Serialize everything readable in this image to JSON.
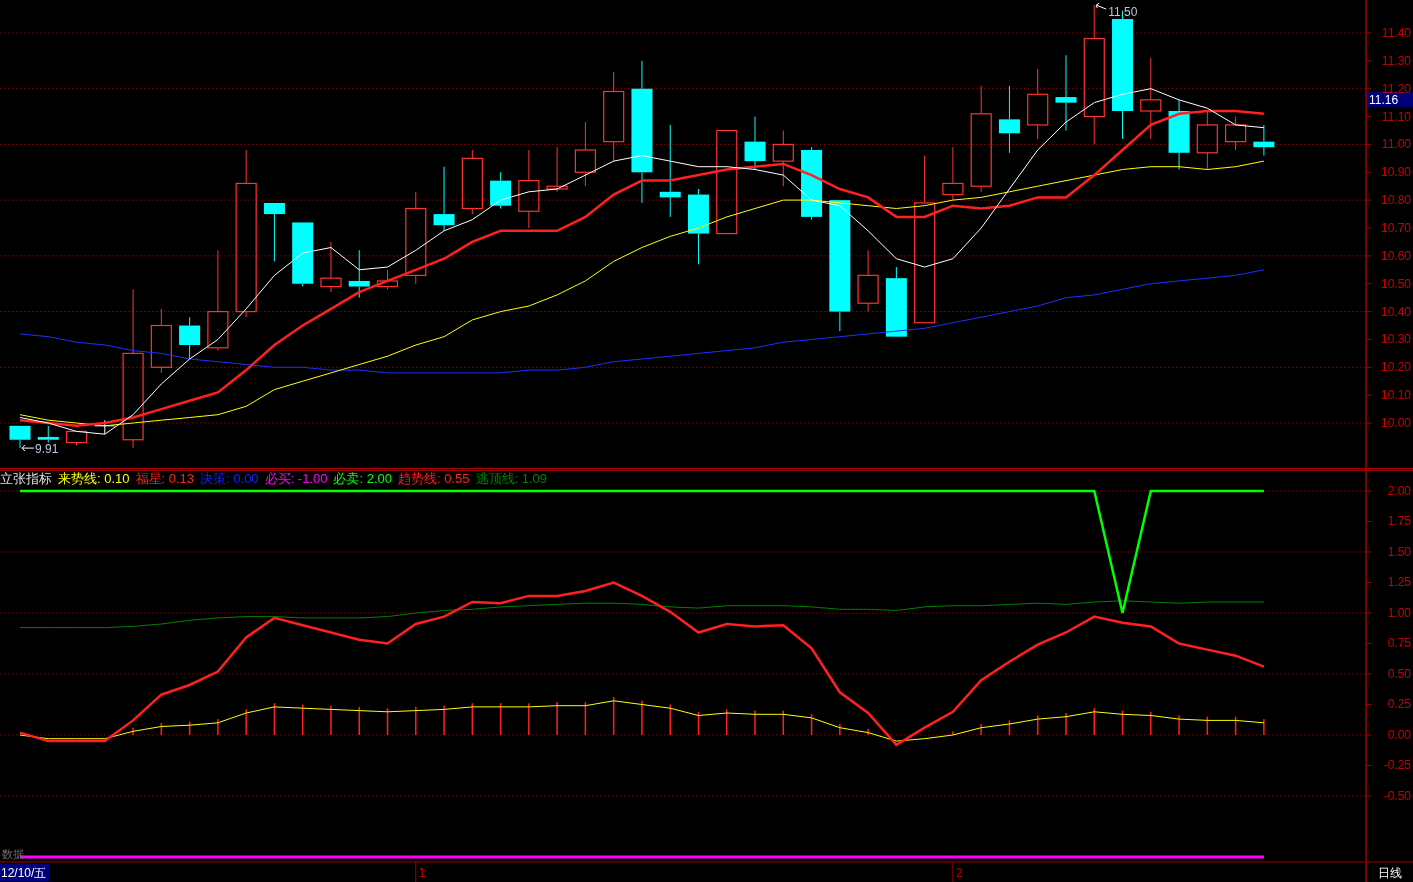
{
  "main_chart": {
    "chart_data": {
      "type": "line",
      "grid": true,
      "ylim": [
        9.8386,
        11.5184
      ],
      "yticks": [
        {
          "value": 10.0,
          "label": "10.00"
        },
        {
          "value": 10.1,
          "label": "10.10"
        },
        {
          "value": 10.2,
          "label": "10.20"
        },
        {
          "value": 10.3,
          "label": "10.30"
        },
        {
          "value": 10.4,
          "label": "10.40"
        },
        {
          "value": 10.5,
          "label": "10.50"
        },
        {
          "value": 10.6,
          "label": "10.60"
        },
        {
          "value": 10.7,
          "label": "10.70"
        },
        {
          "value": 10.8,
          "label": "10.80"
        },
        {
          "value": 10.9,
          "label": "10.90"
        },
        {
          "value": 11.0,
          "label": "11.00"
        },
        {
          "value": 11.1,
          "label": "11.10"
        },
        {
          "value": 11.2,
          "label": "11.20"
        },
        {
          "value": 11.3,
          "label": "11.30"
        },
        {
          "value": 11.4,
          "label": "11.40"
        }
      ],
      "series": [
        {
          "type": "candlestick",
          "ohlc": [
            [
              9.99,
              9.99,
              9.91,
              9.94
            ],
            [
              9.95,
              9.99,
              9.93,
              9.94
            ],
            [
              9.93,
              9.97,
              9.92,
              9.97
            ],
            [
              9.99,
              10.01,
              9.96,
              9.99
            ],
            [
              9.94,
              10.48,
              9.91,
              10.25
            ],
            [
              10.2,
              10.41,
              10.18,
              10.35
            ],
            [
              10.35,
              10.38,
              10.23,
              10.28
            ],
            [
              10.27,
              10.62,
              10.26,
              10.4
            ],
            [
              10.4,
              10.98,
              10.38,
              10.86
            ],
            [
              10.79,
              10.79,
              10.58,
              10.75
            ],
            [
              10.72,
              10.72,
              10.49,
              10.5
            ],
            [
              10.49,
              10.65,
              10.47,
              10.52
            ],
            [
              10.51,
              10.62,
              10.45,
              10.49
            ],
            [
              10.49,
              10.55,
              10.48,
              10.51
            ],
            [
              10.53,
              10.83,
              10.5,
              10.77
            ],
            [
              10.75,
              10.92,
              10.69,
              10.71
            ],
            [
              10.77,
              10.98,
              10.75,
              10.95
            ],
            [
              10.87,
              10.9,
              10.77,
              10.78
            ],
            [
              10.76,
              10.98,
              10.7,
              10.87
            ],
            [
              10.84,
              10.99,
              10.83,
              10.85
            ],
            [
              10.9,
              11.08,
              10.85,
              10.98
            ],
            [
              11.01,
              11.26,
              10.94,
              11.19
            ],
            [
              11.2,
              11.3,
              10.79,
              10.9
            ],
            [
              10.83,
              11.07,
              10.74,
              10.81
            ],
            [
              10.82,
              10.84,
              10.57,
              10.68
            ],
            [
              10.68,
              11.05,
              10.68,
              11.05
            ],
            [
              11.01,
              11.1,
              10.91,
              10.94
            ],
            [
              10.94,
              11.05,
              10.85,
              11.0
            ],
            [
              10.98,
              10.99,
              10.73,
              10.74
            ],
            [
              10.8,
              10.8,
              10.33,
              10.4
            ],
            [
              10.43,
              10.62,
              10.4,
              10.53
            ],
            [
              10.52,
              10.56,
              10.31,
              10.31
            ],
            [
              10.36,
              10.96,
              10.36,
              10.79
            ],
            [
              10.82,
              10.99,
              10.8,
              10.86
            ],
            [
              10.85,
              11.21,
              10.83,
              11.11
            ],
            [
              11.09,
              11.21,
              10.97,
              11.04
            ],
            [
              11.07,
              11.27,
              11.02,
              11.18
            ],
            [
              11.17,
              11.32,
              11.05,
              11.15
            ],
            [
              11.1,
              11.5,
              11.0,
              11.38
            ],
            [
              11.45,
              11.48,
              11.02,
              11.12
            ],
            [
              11.12,
              11.31,
              11.02,
              11.16
            ],
            [
              11.12,
              11.16,
              10.91,
              10.97
            ],
            [
              10.97,
              11.12,
              10.91,
              11.07
            ],
            [
              11.01,
              11.1,
              10.98,
              11.07
            ],
            [
              11.01,
              11.07,
              10.96,
              10.99
            ]
          ]
        },
        {
          "type": "line",
          "color": "#2030ff",
          "values": [
            10.32,
            10.31,
            10.29,
            10.28,
            10.26,
            10.25,
            10.23,
            10.22,
            10.21,
            10.2,
            10.2,
            10.19,
            10.19,
            10.18,
            10.18,
            10.18,
            10.18,
            10.18,
            10.19,
            10.19,
            10.2,
            10.22,
            10.23,
            10.24,
            10.25,
            10.26,
            10.27,
            10.29,
            10.3,
            10.31,
            10.32,
            10.33,
            10.34,
            10.36,
            10.38,
            10.4,
            10.42,
            10.45,
            10.46,
            10.48,
            10.5,
            10.51,
            10.52,
            10.53,
            10.55
          ]
        },
        {
          "type": "line",
          "color": "#ffff00",
          "values": [
            10.03,
            10.01,
            10.0,
            9.99,
            10.0,
            10.01,
            10.02,
            10.03,
            10.06,
            10.12,
            10.15,
            10.18,
            10.21,
            10.24,
            10.28,
            10.31,
            10.37,
            10.4,
            10.42,
            10.46,
            10.51,
            10.58,
            10.63,
            10.67,
            10.7,
            10.74,
            10.77,
            10.8,
            10.8,
            10.79,
            10.78,
            10.77,
            10.78,
            10.8,
            10.81,
            10.83,
            10.85,
            10.87,
            10.89,
            10.91,
            10.92,
            10.92,
            10.91,
            10.92,
            10.94
          ]
        },
        {
          "type": "line",
          "color": "#ff2020",
          "values": [
            10.01,
            10.0,
            9.99,
            10.0,
            10.02,
            10.05,
            10.08,
            10.11,
            10.19,
            10.28,
            10.35,
            10.41,
            10.47,
            10.51,
            10.55,
            10.59,
            10.65,
            10.69,
            10.69,
            10.69,
            10.74,
            10.82,
            10.87,
            10.87,
            10.89,
            10.91,
            10.92,
            10.93,
            10.89,
            10.84,
            10.81,
            10.74,
            10.74,
            10.78,
            10.77,
            10.78,
            10.81,
            10.81,
            10.89,
            10.98,
            11.07,
            11.11,
            11.12,
            11.12,
            11.11
          ]
        },
        {
          "type": "line",
          "color": "#ffffff",
          "values": [
            10.02,
            10.0,
            9.97,
            9.96,
            10.03,
            10.14,
            10.23,
            10.3,
            10.41,
            10.53,
            10.61,
            10.63,
            10.55,
            10.56,
            10.62,
            10.69,
            10.73,
            10.8,
            10.83,
            10.84,
            10.89,
            10.94,
            10.96,
            10.94,
            10.92,
            10.92,
            10.91,
            10.89,
            10.8,
            10.78,
            10.69,
            10.59,
            10.56,
            10.59,
            10.7,
            10.84,
            10.98,
            11.08,
            11.15,
            11.18,
            11.2,
            11.16,
            11.13,
            11.07,
            11.06
          ]
        }
      ],
      "annotations": [
        "11.50",
        "9.91",
        "11.16"
      ]
    }
  },
  "indicator_panel": {
    "title": "立张指标",
    "legend": [
      {
        "label": "来势线:",
        "value": "0.10",
        "color": "#ffff00"
      },
      {
        "label": "福星:",
        "value": "0.13",
        "color": "#ff2020"
      },
      {
        "label": "决策:",
        "value": "0.00",
        "color": "#1020ff"
      },
      {
        "label": "必买:",
        "value": "-1.00",
        "color": "#ff00ff"
      },
      {
        "label": "必卖:",
        "value": "2.00",
        "color": "#00ff00"
      },
      {
        "label": "趋势线:",
        "value": "0.55",
        "color": "#ff2020"
      },
      {
        "label": "逃顶线:",
        "value": "1.09",
        "color": "#008000"
      }
    ],
    "chart_data": {
      "type": "line",
      "grid": true,
      "ylim": [
        -1.041,
        2.172
      ],
      "yticks": [
        {
          "value": -0.5,
          "label": "-0.50"
        },
        {
          "value": -0.25,
          "label": "-0.25"
        },
        {
          "value": 0,
          "label": "0.00"
        },
        {
          "value": 0.25,
          "label": "0.25"
        },
        {
          "value": 0.5,
          "label": "0.50"
        },
        {
          "value": 0.75,
          "label": "0.75"
        },
        {
          "value": 1,
          "label": "1.00"
        },
        {
          "value": 1.25,
          "label": "1.25"
        },
        {
          "value": 1.5,
          "label": "1.50"
        },
        {
          "value": 1.75,
          "label": "1.75"
        },
        {
          "value": 2,
          "label": "2.00"
        }
      ],
      "series": [
        {
          "type": "bar",
          "color": "#ff2020",
          "values": [
            0,
            0,
            0,
            0,
            0.06,
            0.1,
            0.11,
            0.13,
            0.21,
            0.26,
            0.25,
            0.24,
            0.23,
            0.22,
            0.23,
            0.24,
            0.26,
            0.26,
            0.26,
            0.27,
            0.27,
            0.31,
            0.28,
            0.25,
            0.19,
            0.21,
            0.2,
            0.2,
            0.17,
            0.09,
            0.05,
            0,
            0,
            0.03,
            0.09,
            0.12,
            0.16,
            0.18,
            0.22,
            0.2,
            0.19,
            0.16,
            0.15,
            0.15,
            0.13
          ]
        },
        {
          "type": "line",
          "color": "#008000",
          "values": [
            0.88,
            0.88,
            0.88,
            0.88,
            0.89,
            0.91,
            0.94,
            0.96,
            0.97,
            0.97,
            0.96,
            0.96,
            0.96,
            0.97,
            1.0,
            1.02,
            1.03,
            1.05,
            1.06,
            1.07,
            1.08,
            1.08,
            1.07,
            1.05,
            1.04,
            1.06,
            1.06,
            1.06,
            1.05,
            1.03,
            1.03,
            1.02,
            1.05,
            1.06,
            1.06,
            1.07,
            1.08,
            1.07,
            1.09,
            1.1,
            1.09,
            1.08,
            1.09,
            1.09,
            1.09
          ]
        },
        {
          "type": "line",
          "color": "#ffff00",
          "values": [
            0.0,
            -0.03,
            -0.03,
            -0.03,
            0.03,
            0.07,
            0.08,
            0.1,
            0.18,
            0.23,
            0.22,
            0.21,
            0.2,
            0.19,
            0.2,
            0.21,
            0.23,
            0.23,
            0.23,
            0.24,
            0.24,
            0.28,
            0.25,
            0.22,
            0.16,
            0.18,
            0.17,
            0.17,
            0.14,
            0.06,
            0.02,
            -0.05,
            -0.03,
            0.0,
            0.06,
            0.09,
            0.13,
            0.15,
            0.19,
            0.17,
            0.16,
            0.13,
            0.12,
            0.12,
            0.1
          ]
        },
        {
          "type": "line",
          "color": "#ff2020",
          "values": [
            0.02,
            -0.05,
            -0.05,
            -0.05,
            0.12,
            0.33,
            0.41,
            0.52,
            0.8,
            0.96,
            0.9,
            0.84,
            0.78,
            0.75,
            0.91,
            0.97,
            1.09,
            1.08,
            1.14,
            1.14,
            1.18,
            1.25,
            1.14,
            1.01,
            0.84,
            0.91,
            0.89,
            0.9,
            0.71,
            0.35,
            0.18,
            -0.08,
            0.06,
            0.19,
            0.45,
            0.6,
            0.74,
            0.84,
            0.97,
            0.92,
            0.89,
            0.75,
            0.7,
            0.65,
            0.56
          ]
        },
        {
          "type": "line",
          "color": "#00ff00",
          "values": [
            2,
            2,
            2,
            2,
            2,
            2,
            2,
            2,
            2,
            2,
            2,
            2,
            2,
            2,
            2,
            2,
            2,
            2,
            2,
            2,
            2,
            2,
            2,
            2,
            2,
            2,
            2,
            2,
            2,
            2,
            2,
            2,
            2,
            2,
            2,
            2,
            2,
            2,
            2,
            1,
            2,
            2,
            2,
            2,
            2
          ]
        },
        {
          "type": "line",
          "color": "#ff00ff",
          "values": [
            -1,
            -1,
            -1,
            -1,
            -1,
            -1,
            -1,
            -1,
            -1,
            -1,
            -1,
            -1,
            -1,
            -1,
            -1,
            -1,
            -1,
            -1,
            -1,
            -1,
            -1,
            -1,
            -1,
            -1,
            -1,
            -1,
            -1,
            -1,
            -1,
            -1,
            -1,
            -1,
            -1,
            -1,
            -1,
            -1,
            -1,
            -1,
            -1,
            -1,
            -1,
            -1,
            -1,
            -1,
            -1
          ]
        }
      ]
    },
    "footer_note": "数据"
  },
  "time_axis": [
    {
      "label": "12/10/五",
      "selected": true
    },
    {
      "label": "1",
      "selected": false
    },
    {
      "label": "2",
      "selected": false
    }
  ],
  "period_button": "日线"
}
